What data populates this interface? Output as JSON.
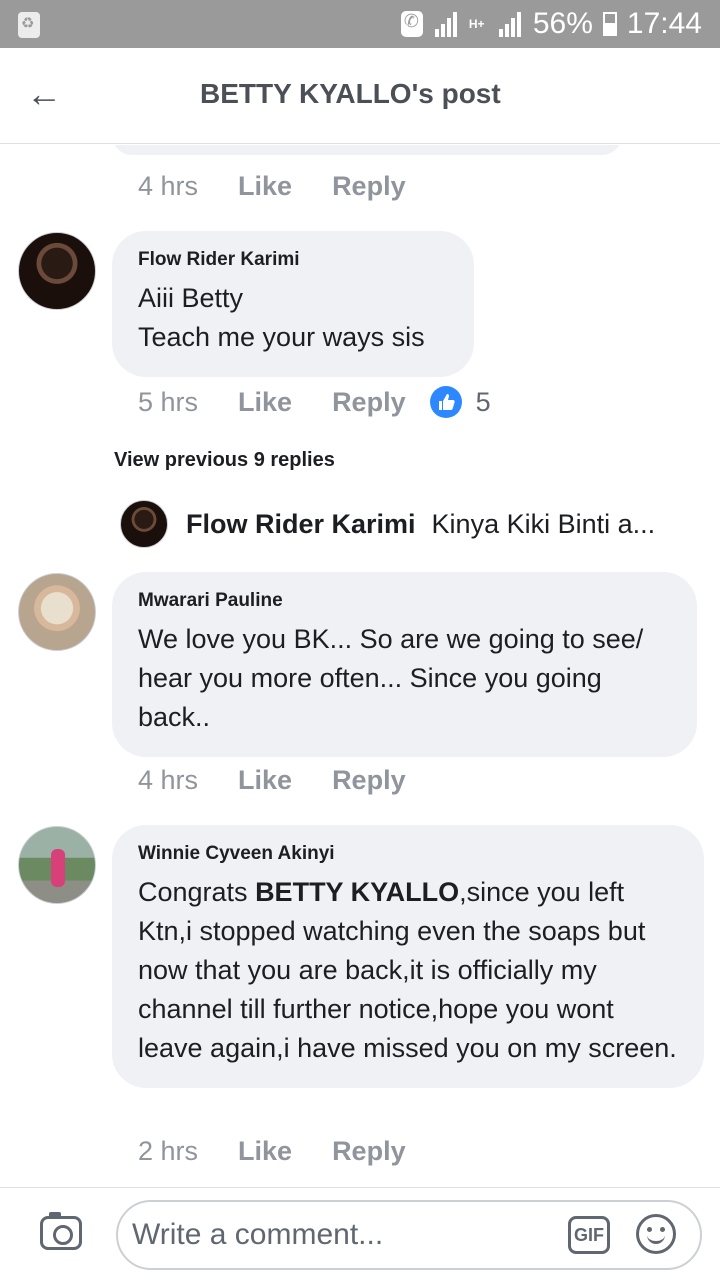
{
  "status_bar": {
    "battery": "56%",
    "time": "17:44",
    "network": "H+"
  },
  "header": {
    "back_icon": "arrow-left-icon",
    "title": "BETTY KYALLO's post"
  },
  "comments": [
    {
      "author": "",
      "time": "4 hrs",
      "like_label": "Like",
      "reply_label": "Reply"
    },
    {
      "author": "Flow Rider Karimi",
      "text_lines": [
        "Aiii Betty",
        "Teach me your ways sis"
      ],
      "time": "5 hrs",
      "like_label": "Like",
      "reply_label": "Reply",
      "reaction_count": "5"
    },
    {
      "author": "Mwarari Pauline",
      "text": "We love you BK... So are we going to see/ hear you more often... Since you going back..",
      "time": "4 hrs",
      "like_label": "Like",
      "reply_label": "Reply"
    },
    {
      "author": "Winnie Cyveen Akinyi",
      "text_pre": "Congrats ",
      "text_tag": "BETTY KYALLO",
      "text_post": ",since you left Ktn,i stopped watching  even the soaps but now that you are back,it is officially my channel till further notice,hope you wont leave again,i have missed you on my screen.",
      "time": "2 hrs",
      "like_label": "Like",
      "reply_label": "Reply"
    }
  ],
  "replies": {
    "view_previous": "View previous 9 replies",
    "latest_author": "Flow Rider Karimi",
    "latest_text": "Kinya Kiki Binti a..."
  },
  "footer": {
    "placeholder": "Write a comment...",
    "gif_label": "GIF",
    "camera_icon": "camera-icon",
    "emoji_icon": "smiley-icon"
  },
  "colors": {
    "bubble": "#f0f1f4",
    "meta": "#90949c",
    "like_blue": "#2d88ff"
  }
}
